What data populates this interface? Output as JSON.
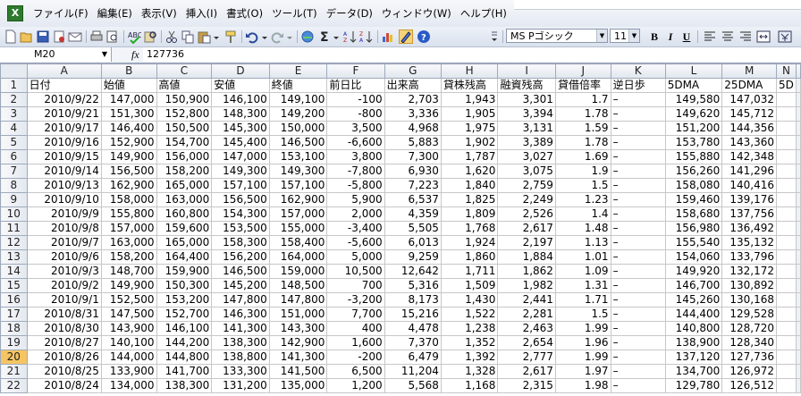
{
  "menu": {
    "items": [
      "ファイル(F)",
      "編集(E)",
      "表示(V)",
      "挿入(I)",
      "書式(O)",
      "ツール(T)",
      "データ(D)",
      "ウィンドウ(W)",
      "ヘルプ(H)"
    ]
  },
  "toolbar": {
    "icons": [
      "new-icon",
      "open-icon",
      "save-icon",
      "permission-icon",
      "email-icon",
      "print-icon",
      "print-preview-icon",
      "spelling-icon",
      "research-icon",
      "cut-icon",
      "copy-icon",
      "paste-icon",
      "format-painter-icon",
      "undo-icon",
      "redo-icon",
      "hyperlink-icon",
      "autosum-icon",
      "sort-ascending-icon",
      "sort-descending-icon",
      "chart-wizard-icon",
      "drawing-icon",
      "help-icon"
    ],
    "font_name": "MS Pゴシック",
    "font_size": "11",
    "bold_label": "B",
    "italic_label": "I",
    "underline_label": "U"
  },
  "formula_bar": {
    "name_box": "M20",
    "fx_label": "fx",
    "formula": "127736"
  },
  "sheet": {
    "selected_row": 20,
    "columns": [
      "A",
      "B",
      "C",
      "D",
      "E",
      "F",
      "G",
      "H",
      "I",
      "J",
      "K",
      "L",
      "M",
      "N"
    ],
    "rows": [
      {
        "n": "1",
        "cells": [
          "日付",
          "始値",
          "高値",
          "安値",
          "終値",
          "前日比",
          "出来高",
          "貸株残高",
          "融資残高",
          "貸借倍率",
          "逆日歩",
          "5DMA",
          "25DMA",
          "5D"
        ]
      },
      {
        "n": "2",
        "cells": [
          "2010/9/22",
          "147,000",
          "150,900",
          "146,100",
          "149,100",
          "-100",
          "2,703",
          "1,943",
          "3,301",
          "1.7",
          "–",
          "149,580",
          "147,032",
          ""
        ]
      },
      {
        "n": "3",
        "cells": [
          "2010/9/21",
          "151,300",
          "152,800",
          "148,300",
          "149,200",
          "-800",
          "3,336",
          "1,905",
          "3,394",
          "1.78",
          "–",
          "149,620",
          "145,712",
          ""
        ]
      },
      {
        "n": "4",
        "cells": [
          "2010/9/17",
          "146,400",
          "150,500",
          "145,300",
          "150,000",
          "3,500",
          "4,968",
          "1,975",
          "3,131",
          "1.59",
          "–",
          "151,200",
          "144,356",
          ""
        ]
      },
      {
        "n": "5",
        "cells": [
          "2010/9/16",
          "152,900",
          "154,700",
          "145,400",
          "146,500",
          "-6,600",
          "5,883",
          "1,902",
          "3,389",
          "1.78",
          "–",
          "153,780",
          "143,360",
          ""
        ]
      },
      {
        "n": "6",
        "cells": [
          "2010/9/15",
          "149,900",
          "156,000",
          "147,000",
          "153,100",
          "3,800",
          "7,300",
          "1,787",
          "3,027",
          "1.69",
          "–",
          "155,880",
          "142,348",
          ""
        ]
      },
      {
        "n": "7",
        "cells": [
          "2010/9/14",
          "156,500",
          "158,200",
          "149,300",
          "149,300",
          "-7,800",
          "6,930",
          "1,620",
          "3,075",
          "1.9",
          "–",
          "156,260",
          "141,296",
          ""
        ]
      },
      {
        "n": "8",
        "cells": [
          "2010/9/13",
          "162,900",
          "165,000",
          "157,100",
          "157,100",
          "-5,800",
          "7,223",
          "1,840",
          "2,759",
          "1.5",
          "–",
          "158,080",
          "140,416",
          ""
        ]
      },
      {
        "n": "9",
        "cells": [
          "2010/9/10",
          "158,000",
          "163,000",
          "156,500",
          "162,900",
          "5,900",
          "6,537",
          "1,825",
          "2,249",
          "1.23",
          "–",
          "159,460",
          "139,176",
          ""
        ]
      },
      {
        "n": "10",
        "cells": [
          "2010/9/9",
          "155,800",
          "160,800",
          "154,300",
          "157,000",
          "2,000",
          "4,359",
          "1,809",
          "2,526",
          "1.4",
          "–",
          "158,680",
          "137,756",
          ""
        ]
      },
      {
        "n": "11",
        "cells": [
          "2010/9/8",
          "157,000",
          "159,600",
          "153,500",
          "155,000",
          "-3,400",
          "5,505",
          "1,768",
          "2,617",
          "1.48",
          "–",
          "156,980",
          "136,492",
          ""
        ]
      },
      {
        "n": "12",
        "cells": [
          "2010/9/7",
          "163,000",
          "165,000",
          "158,300",
          "158,400",
          "-5,600",
          "6,013",
          "1,924",
          "2,197",
          "1.13",
          "–",
          "155,540",
          "135,132",
          ""
        ]
      },
      {
        "n": "13",
        "cells": [
          "2010/9/6",
          "158,200",
          "164,400",
          "156,200",
          "164,000",
          "5,000",
          "9,259",
          "1,860",
          "1,884",
          "1.01",
          "–",
          "154,060",
          "133,796",
          ""
        ]
      },
      {
        "n": "14",
        "cells": [
          "2010/9/3",
          "148,700",
          "159,900",
          "146,500",
          "159,000",
          "10,500",
          "12,642",
          "1,711",
          "1,862",
          "1.09",
          "–",
          "149,920",
          "132,172",
          ""
        ]
      },
      {
        "n": "15",
        "cells": [
          "2010/9/2",
          "149,900",
          "150,300",
          "145,200",
          "148,500",
          "700",
          "5,316",
          "1,509",
          "1,982",
          "1.31",
          "–",
          "146,700",
          "130,892",
          ""
        ]
      },
      {
        "n": "16",
        "cells": [
          "2010/9/1",
          "152,500",
          "153,200",
          "147,800",
          "147,800",
          "-3,200",
          "8,173",
          "1,430",
          "2,441",
          "1.71",
          "–",
          "145,260",
          "130,168",
          ""
        ]
      },
      {
        "n": "17",
        "cells": [
          "2010/8/31",
          "147,500",
          "152,700",
          "146,300",
          "151,000",
          "7,700",
          "15,216",
          "1,522",
          "2,281",
          "1.5",
          "–",
          "144,400",
          "129,528",
          ""
        ]
      },
      {
        "n": "18",
        "cells": [
          "2010/8/30",
          "143,900",
          "146,100",
          "141,300",
          "143,300",
          "400",
          "4,478",
          "1,238",
          "2,463",
          "1.99",
          "–",
          "140,800",
          "128,720",
          ""
        ]
      },
      {
        "n": "19",
        "cells": [
          "2010/8/27",
          "140,100",
          "144,200",
          "138,300",
          "142,900",
          "1,600",
          "7,370",
          "1,352",
          "2,654",
          "1.96",
          "–",
          "138,900",
          "128,340",
          ""
        ]
      },
      {
        "n": "20",
        "cells": [
          "2010/8/26",
          "144,000",
          "144,800",
          "138,800",
          "141,300",
          "-200",
          "6,479",
          "1,392",
          "2,777",
          "1.99",
          "–",
          "137,120",
          "127,736",
          ""
        ]
      },
      {
        "n": "21",
        "cells": [
          "2010/8/25",
          "133,900",
          "141,700",
          "133,300",
          "141,500",
          "6,500",
          "11,204",
          "1,328",
          "2,617",
          "1.97",
          "–",
          "134,700",
          "126,972",
          ""
        ]
      },
      {
        "n": "22",
        "cells": [
          "2010/8/24",
          "134,000",
          "138,300",
          "131,200",
          "135,000",
          "1,200",
          "5,568",
          "1,168",
          "2,315",
          "1.98",
          "–",
          "129,780",
          "126,512",
          ""
        ]
      }
    ]
  }
}
